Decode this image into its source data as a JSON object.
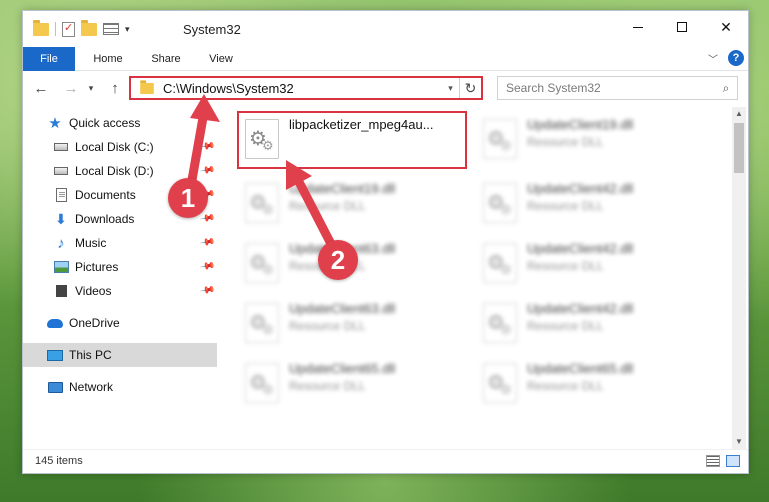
{
  "window": {
    "title": "System32"
  },
  "caption": {
    "minimize": "minimize",
    "maximize": "maximize",
    "close": "✕"
  },
  "ribbon": {
    "tabs": [
      "File",
      "Home",
      "Share",
      "View"
    ],
    "help": "?"
  },
  "nav": {
    "back": "←",
    "forward": "→",
    "recent": "▾",
    "up": "↑",
    "address": "C:\\Windows\\System32",
    "address_dropdown": "▾",
    "refresh": "↻",
    "search_placeholder": "Search System32",
    "search_icon": "⌕"
  },
  "sidebar": {
    "items": [
      {
        "label": "Quick access",
        "icon": "star-icon"
      },
      {
        "label": "Local Disk (C:)",
        "icon": "drive-icon",
        "pinned": true
      },
      {
        "label": "Local Disk (D:)",
        "icon": "drive-icon",
        "pinned": true
      },
      {
        "label": "Documents",
        "icon": "documents-icon",
        "pinned": true
      },
      {
        "label": "Downloads",
        "icon": "downloads-icon",
        "pinned": true
      },
      {
        "label": "Music",
        "icon": "music-icon",
        "pinned": true
      },
      {
        "label": "Pictures",
        "icon": "pictures-icon",
        "pinned": true
      },
      {
        "label": "Videos",
        "icon": "videos-icon",
        "pinned": true
      },
      {
        "label": "OneDrive",
        "icon": "onedrive-icon"
      },
      {
        "label": "This PC",
        "icon": "this-pc-icon",
        "selected": true
      },
      {
        "label": "Network",
        "icon": "network-icon"
      }
    ]
  },
  "files": [
    {
      "name": "libpacketizer_mpeg4au...",
      "type": "",
      "highlighted": true
    },
    {
      "name": "UpdateClient19.dll",
      "type": "Resource DLL"
    },
    {
      "name": "UpdateClient19.dll",
      "type": "Resource DLL"
    },
    {
      "name": "UpdateClient42.dll",
      "type": "Resource DLL"
    },
    {
      "name": "UpdateClient63.dll",
      "type": "Resource DLL"
    },
    {
      "name": "UpdateClient42.dll",
      "type": "Resource DLL"
    },
    {
      "name": "UpdateClient63.dll",
      "type": "Resource DLL"
    },
    {
      "name": "UpdateClient42.dll",
      "type": "Resource DLL"
    },
    {
      "name": "UpdateClient65.dll",
      "type": "Resource DLL"
    },
    {
      "name": "UpdateClient65.dll",
      "type": "Resource DLL"
    }
  ],
  "status": {
    "item_count": "145 items"
  },
  "callouts": {
    "step1": "1",
    "step2": "2"
  },
  "colors": {
    "accent": "#1a69c9",
    "highlight_border": "#d9333f",
    "badge": "#e0404c"
  }
}
